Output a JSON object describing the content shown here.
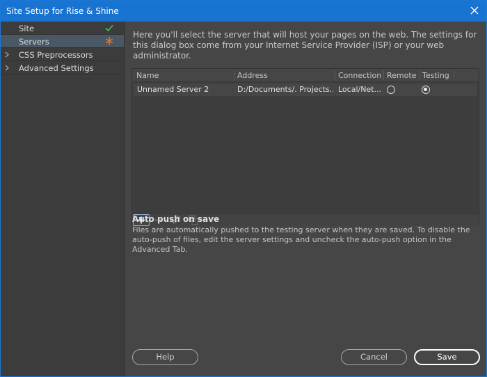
{
  "window": {
    "title": "Site Setup for Rise & Shine"
  },
  "sidebar": {
    "items": [
      {
        "label": "Site",
        "mark": "check-icon"
      },
      {
        "label": "Servers",
        "mark": "asterisk-icon"
      },
      {
        "label": "CSS Preprocessors",
        "mark": "chevron-right-icon"
      },
      {
        "label": "Advanced Settings",
        "mark": "chevron-right-icon"
      }
    ]
  },
  "main": {
    "intro": "Here you'll select the server that will host your pages on the web. The settings for this dialog box come from your Internet Service Provider (ISP) or your web administrator.",
    "table": {
      "columns": [
        "Name",
        "Address",
        "Connection",
        "Remote",
        "Testing"
      ],
      "rows": [
        {
          "name": "Unnamed Server 2",
          "address": "D:/Documents/. Projects...",
          "connection": "Local/Net...",
          "remote": false,
          "testing": true
        }
      ]
    },
    "toolbar": {
      "add": "plus-icon",
      "remove": "minus-icon",
      "edit": "pencil-icon",
      "duplicate": "duplicate-icon"
    },
    "auto_push": {
      "title": "Auto push on save",
      "body": "Files are automatically pushed to the testing server when they are saved. To disable the auto-push of files, edit the server settings and uncheck the auto-push option in the Advanced Tab."
    }
  },
  "buttons": {
    "help": "Help",
    "cancel": "Cancel",
    "save": "Save"
  },
  "colors": {
    "titlebar": "#1873d1",
    "selected_row": "#4a5865",
    "check": "#4fbf4f",
    "asterisk": "#e0752a"
  }
}
